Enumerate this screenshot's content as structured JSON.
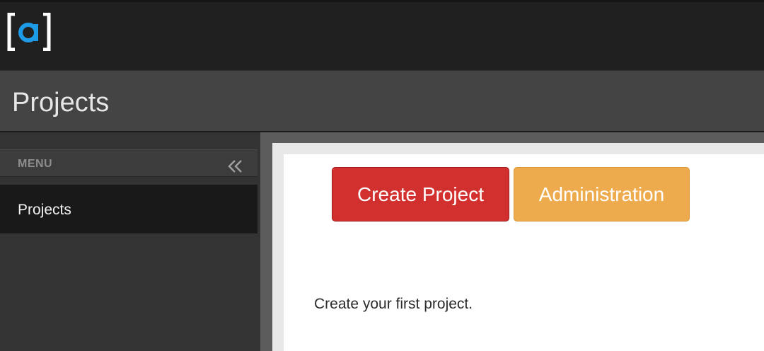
{
  "header": {
    "logo": {
      "left_bracket": "[",
      "letter": "a",
      "right_bracket": "]",
      "accent_color": "#1e9be6"
    }
  },
  "page": {
    "title": "Projects"
  },
  "sidebar": {
    "menu_label": "MENU",
    "collapse_icon": "double-chevron-left-icon",
    "items": [
      {
        "label": "Projects",
        "active": true
      }
    ]
  },
  "main": {
    "buttons": {
      "create_label": "Create Project",
      "create_color": "#d2302f",
      "admin_label": "Administration",
      "admin_color": "#eeab4d"
    },
    "empty_message": "Create your first project."
  }
}
